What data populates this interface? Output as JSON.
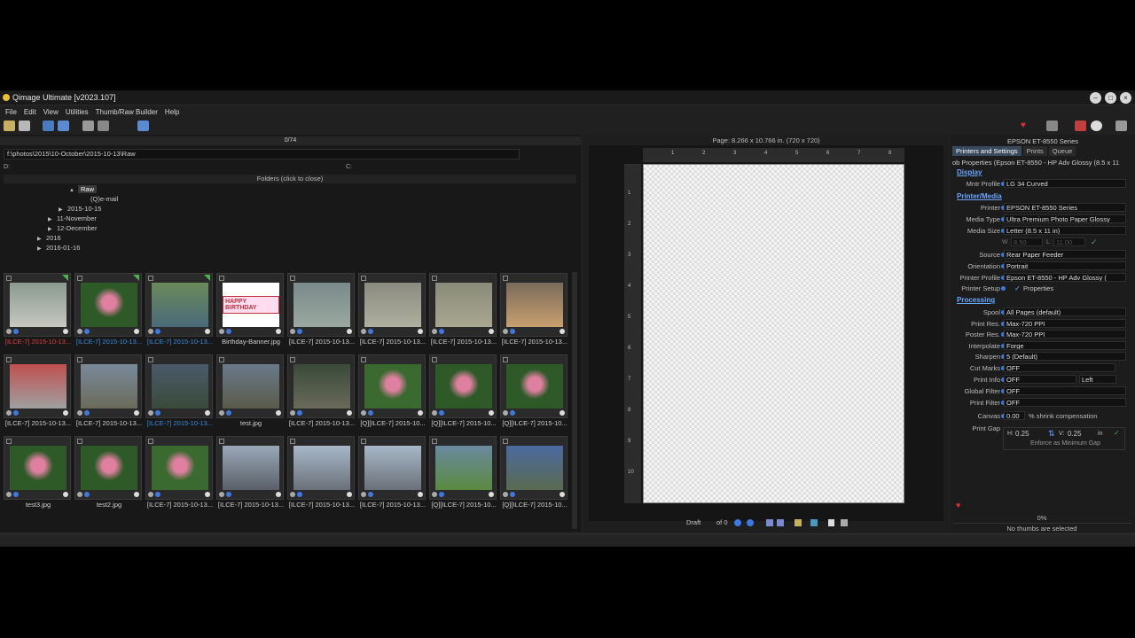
{
  "app": {
    "title": "Qimage Ultimate [v2023.107]"
  },
  "menu": [
    "File",
    "Edit",
    "View",
    "Utilities",
    "Thumb/Raw Builder",
    "Help"
  ],
  "left": {
    "count": "0/74",
    "path": "f:\\photos\\2015\\10-October\\2015-10-13\\Raw",
    "d_label": "D:",
    "c_label": "C:",
    "folders_header": "Folders (click to close)",
    "tree": [
      "Raw",
      "(Q)e-mail",
      "2015-10-15",
      "11-November",
      "12-December",
      "2016",
      "2016-01-16"
    ],
    "thumbs": [
      {
        "caption": "[ILCE-7] 2015-10-13...",
        "color": "red"
      },
      {
        "caption": "[ILCE-7] 2015-10-13...",
        "color": "blue"
      },
      {
        "caption": "[ILCE-7] 2015-10-13...",
        "color": "blue"
      },
      {
        "caption": "Birthday-Banner.jpg",
        "color": "normal"
      },
      {
        "caption": "[ILCE-7] 2015-10-13...",
        "color": "normal"
      },
      {
        "caption": "[ILCE-7] 2015-10-13...",
        "color": "normal"
      },
      {
        "caption": "[ILCE-7] 2015-10-13...",
        "color": "normal"
      },
      {
        "caption": "[ILCE-7] 2015-10-13...",
        "color": "normal"
      },
      {
        "caption": "[ILCE-7] 2015-10-13...",
        "color": "normal"
      },
      {
        "caption": "[ILCE-7] 2015-10-13...",
        "color": "normal"
      },
      {
        "caption": "[ILCE-7] 2015-10-13...",
        "color": "blue"
      },
      {
        "caption": "test.jpg",
        "color": "normal"
      },
      {
        "caption": "[ILCE-7] 2015-10-13...",
        "color": "normal"
      },
      {
        "caption": "[Q][ILCE-7] 2015-10...",
        "color": "normal"
      },
      {
        "caption": "[Q][ILCE-7] 2015-10...",
        "color": "normal"
      },
      {
        "caption": "[Q][ILCE-7] 2015-10...",
        "color": "normal"
      },
      {
        "caption": "test3.jpg",
        "color": "normal"
      },
      {
        "caption": "test2.jpg",
        "color": "normal"
      },
      {
        "caption": "[ILCE-7] 2015-10-13...",
        "color": "normal"
      },
      {
        "caption": "[ILCE-7] 2015-10-13...",
        "color": "normal"
      },
      {
        "caption": "[ILCE-7] 2015-10-13...",
        "color": "normal"
      },
      {
        "caption": "[ILCE-7] 2015-10-13...",
        "color": "normal"
      },
      {
        "caption": "[Q][ILCE-7] 2015-10...",
        "color": "normal"
      },
      {
        "caption": "[Q][ILCE-7] 2015-10...",
        "color": "normal"
      }
    ],
    "banner_text": "HAPPY BIRTHDAY"
  },
  "center": {
    "page_info": "Page: 8.266 x 10.766 in. (720 x 720)",
    "draft_label": "Draft",
    "of_label": "of 0",
    "ruler_top": [
      "1",
      "2",
      "3",
      "4",
      "5",
      "6",
      "7",
      "8"
    ],
    "ruler_left": [
      "1",
      "2",
      "3",
      "4",
      "5",
      "6",
      "7",
      "8",
      "9",
      "10"
    ]
  },
  "right": {
    "printer_title": "EPSON ET-8550 Series",
    "tabs": [
      "Printers and Settings",
      "Prints",
      "Queue"
    ],
    "job_props": "ob Properties (Epson ET-8550 - HP Adv Glossy (8.5 x 11",
    "sections": {
      "display": "Display",
      "printer_media": "Printer/Media",
      "processing": "Processing"
    },
    "mntr_profile": {
      "label": "Mntr Profile",
      "value": "LG 34 Curved"
    },
    "printer": {
      "label": "Printer",
      "value": "EPSON ET-8550 Series"
    },
    "media_type": {
      "label": "Media Type",
      "value": "Ultra Premium Photo Paper Glossy"
    },
    "media_size": {
      "label": "Media Size",
      "value": "Letter (8.5 x 11 in)"
    },
    "wl": {
      "w": "8.50",
      "l": "11.00"
    },
    "source": {
      "label": "Source",
      "value": "Rear Paper Feeder"
    },
    "orientation": {
      "label": "Orientation",
      "value": "Portrait"
    },
    "printer_profile": {
      "label": "Printer Profile",
      "value": "Epson ET-8550 - HP Adv Glossy ("
    },
    "printer_setup": {
      "label": "Printer Setup",
      "value": "Properties"
    },
    "spool": {
      "label": "Spool",
      "value": "All Pages (default)"
    },
    "print_res": {
      "label": "Print Res.",
      "value": "Max-720 PPI"
    },
    "poster_res": {
      "label": "Poster Res.",
      "value": "Max-720 PPI"
    },
    "interpolate": {
      "label": "Interpolate",
      "value": "Forge"
    },
    "sharpen": {
      "label": "Sharpen",
      "value": "5 (Default)"
    },
    "cut_marks": {
      "label": "Cut Marks",
      "value": "OFF"
    },
    "print_info": {
      "label": "Print Info",
      "value": "OFF",
      "pos": "Left"
    },
    "global_filter": {
      "label": "Global Filter",
      "value": "OFF"
    },
    "print_filter": {
      "label": "Print Filter",
      "value": "OFF"
    },
    "canvas": {
      "label": "Canvas",
      "value": "0.00",
      "suffix": "% shrink compensation"
    },
    "print_gap": {
      "label": "Print Gap",
      "h_label": "H:",
      "h": "0.25",
      "v_label": "V:",
      "v": "0.25",
      "unit": "in",
      "enforce": "Enforce as Minimum Gap"
    },
    "progress": "0%",
    "status": "No thumbs are selected"
  }
}
